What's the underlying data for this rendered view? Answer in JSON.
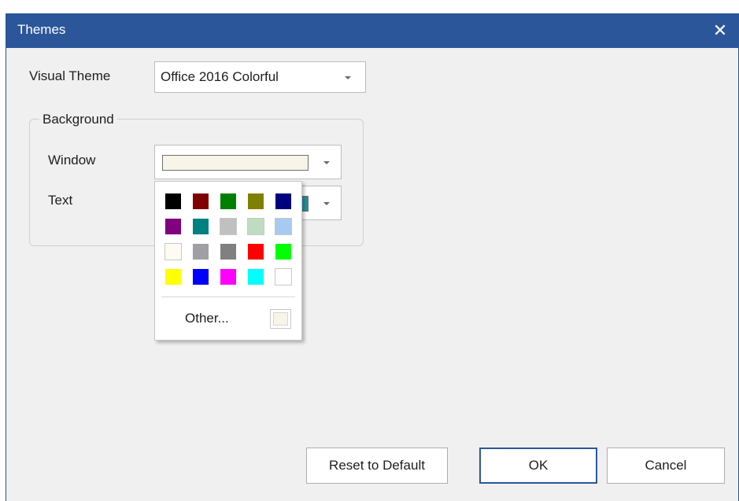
{
  "dialog": {
    "title": "Themes",
    "close_glyph": "✕"
  },
  "visual_theme": {
    "label": "Visual Theme",
    "value": "Office 2016 Colorful"
  },
  "background": {
    "group_label": "Background",
    "window_label": "Window",
    "window_color": "#f7f5e8",
    "text_label": "Text",
    "text_color": "#2a8f9a"
  },
  "color_picker": {
    "colors": [
      "#000000",
      "#800000",
      "#008000",
      "#808000",
      "#000080",
      "#800080",
      "#008080",
      "#c0c0c0",
      "#c0dcc0",
      "#a6caf0",
      "#fffbf0",
      "#a0a0a4",
      "#808080",
      "#ff0000",
      "#00ff00",
      "#ffff00",
      "#0000ff",
      "#ff00ff",
      "#00ffff",
      "#ffffff"
    ],
    "other_label": "Other...",
    "other_color": "#f7f5e8"
  },
  "buttons": {
    "reset_label": "Reset to Default",
    "ok_label": "OK",
    "cancel_label": "Cancel"
  },
  "colors": {
    "title_bar": "#2b579a",
    "window_bg": "#f0f0f0"
  }
}
